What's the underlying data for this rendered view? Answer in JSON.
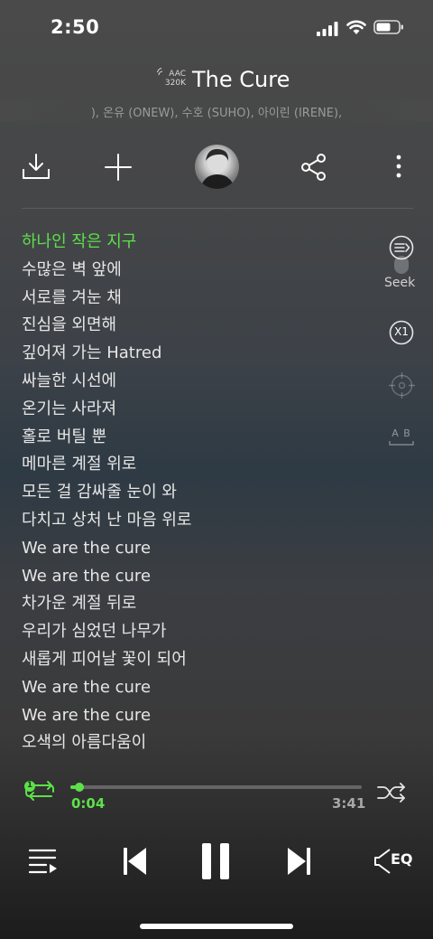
{
  "status_bar": {
    "time": "2:50"
  },
  "header": {
    "quality_line1": "AAC",
    "quality_line2": "320K",
    "title": "The Cure",
    "artists": "), 온유 (ONEW), 수호 (SUHO), 아이린 (IRENE),"
  },
  "lyrics": {
    "lines": [
      "하나인 작은 지구",
      "수많은 벽 앞에",
      "서로를 겨눈 채",
      "진심을 외면해",
      "깊어져 가는 Hatred",
      "싸늘한 시선에",
      "온기는 사라져",
      "홀로 버틸 뿐",
      "메마른 계절 위로",
      "모든 걸 감싸줄 눈이 와",
      "다치고 상처 난 마음 위로",
      "We are the cure",
      "We are the cure",
      "차가운 계절 뒤로",
      "우리가 심었던 나무가",
      "새롭게 피어날 꽃이 되어",
      "We are the cure",
      "We are the cure",
      "오색의 아름다움이"
    ],
    "active_index": 0
  },
  "side_controls": {
    "seek_label": "Seek",
    "speed_label": "X1",
    "ab_label": "A B"
  },
  "playback": {
    "repeat_badge": "1",
    "current_time": "0:04",
    "total_time": "3:41",
    "progress": 0.018,
    "eq_label": "EQ"
  },
  "colors": {
    "accent": "#5ee04a",
    "text": "#e6e6e6",
    "muted": "#9a9a9a"
  }
}
